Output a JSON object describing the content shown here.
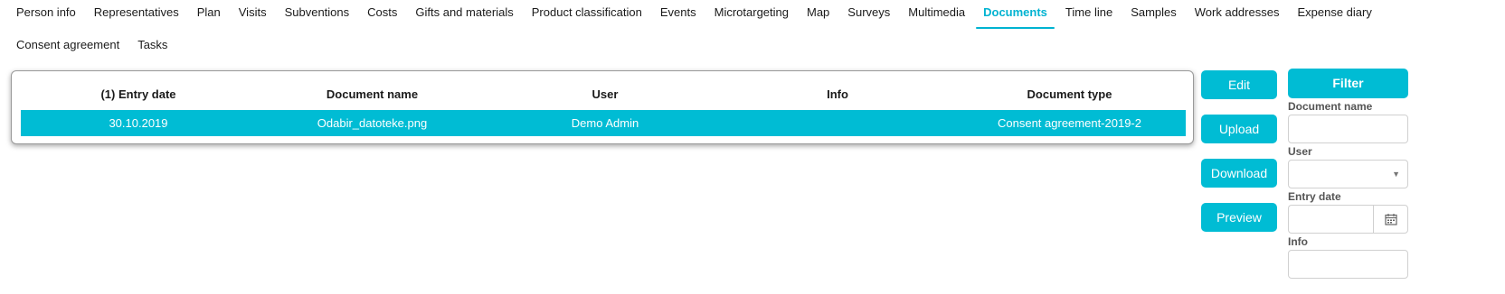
{
  "tabs": {
    "row1": [
      "Person info",
      "Representatives",
      "Plan",
      "Visits",
      "Subventions",
      "Costs",
      "Gifts and materials",
      "Product classification",
      "Events",
      "Microtargeting",
      "Map",
      "Surveys",
      "Multimedia",
      "Documents",
      "Time line",
      "Samples",
      "Work addresses",
      "Expense diary"
    ],
    "row2": [
      "Consent agreement",
      "Tasks"
    ],
    "active": "Documents"
  },
  "table": {
    "columns": [
      "(1) Entry date",
      "Document name",
      "User",
      "Info",
      "Document type"
    ],
    "rows": [
      {
        "entry_date": "30.10.2019",
        "document_name": "Odabir_datoteke.png",
        "user": "Demo Admin",
        "info": "",
        "document_type": "Consent agreement-2019-2"
      }
    ]
  },
  "actions": {
    "edit": "Edit",
    "upload": "Upload",
    "download": "Download",
    "preview": "Preview"
  },
  "filter": {
    "button": "Filter",
    "document_name_label": "Document name",
    "document_name_value": "",
    "user_label": "User",
    "user_value": "",
    "entry_date_label": "Entry date",
    "entry_date_value": "",
    "info_label": "Info",
    "info_value": ""
  },
  "colors": {
    "accent": "#00bcd4",
    "active_tab": "#00b3d1"
  },
  "icons": {
    "select_caret": "chevron-down-icon",
    "calendar": "calendar-icon"
  }
}
